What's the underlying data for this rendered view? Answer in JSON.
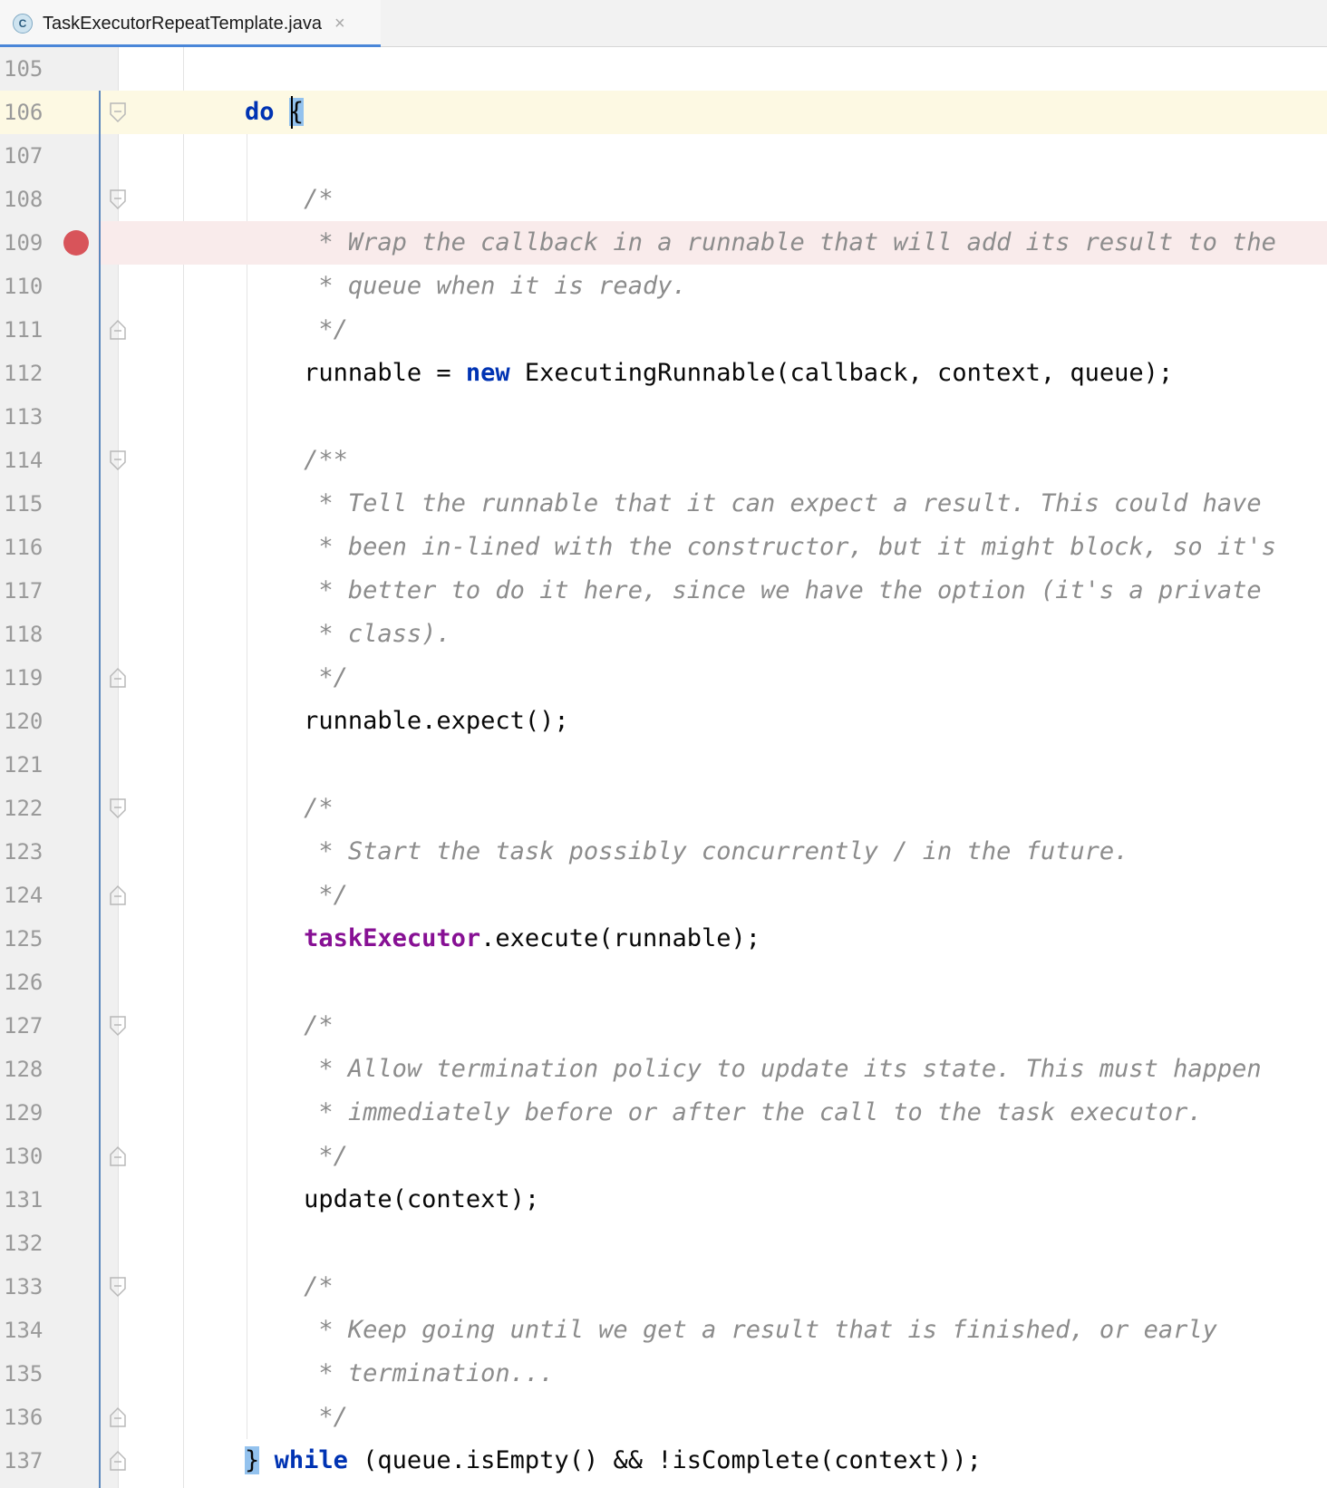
{
  "tab": {
    "icon": "class-icon",
    "icon_letter": "C",
    "title": "TaskExecutorRepeatTemplate.java",
    "close_glyph": "×"
  },
  "colors": {
    "keyword": "#0033b3",
    "field": "#871094",
    "comment": "#8c8c8c",
    "current_line": "#fdf9e3",
    "breakpoint_line": "#f9ebeb",
    "breakpoint": "#d8545a",
    "tab_underline": "#4a86d8"
  },
  "editor": {
    "current_line": 106,
    "breakpoint_line": 109,
    "lines": [
      {
        "n": "105",
        "segs": []
      },
      {
        "n": "106",
        "fold": "open",
        "segs": [
          {
            "t": "        "
          },
          {
            "t": "do",
            "c": "kw"
          },
          {
            "t": " "
          },
          {
            "t": "{",
            "c": "brace-match"
          }
        ]
      },
      {
        "n": "107",
        "segs": []
      },
      {
        "n": "108",
        "fold": "open",
        "segs": [
          {
            "t": "            "
          },
          {
            "t": "/*",
            "c": "comment"
          }
        ]
      },
      {
        "n": "109",
        "segs": [
          {
            "t": "             "
          },
          {
            "t": "* Wrap the callback in a runnable that will add its result to the",
            "c": "comment"
          }
        ]
      },
      {
        "n": "110",
        "segs": [
          {
            "t": "             "
          },
          {
            "t": "* queue when it is ready.",
            "c": "comment"
          }
        ]
      },
      {
        "n": "111",
        "fold": "close",
        "segs": [
          {
            "t": "             "
          },
          {
            "t": "*/",
            "c": "comment"
          }
        ]
      },
      {
        "n": "112",
        "segs": [
          {
            "t": "            runnable = "
          },
          {
            "t": "new",
            "c": "kw"
          },
          {
            "t": " ExecutingRunnable(callback, context, queue);"
          }
        ]
      },
      {
        "n": "113",
        "segs": []
      },
      {
        "n": "114",
        "fold": "open",
        "segs": [
          {
            "t": "            "
          },
          {
            "t": "/**",
            "c": "comment"
          }
        ]
      },
      {
        "n": "115",
        "segs": [
          {
            "t": "             "
          },
          {
            "t": "* Tell the runnable that it can expect a result. This could have",
            "c": "comment"
          }
        ]
      },
      {
        "n": "116",
        "segs": [
          {
            "t": "             "
          },
          {
            "t": "* been in-lined with the constructor, but it might block, so it's",
            "c": "comment"
          }
        ]
      },
      {
        "n": "117",
        "segs": [
          {
            "t": "             "
          },
          {
            "t": "* better to do it here, since we have the option (it's a private",
            "c": "comment"
          }
        ]
      },
      {
        "n": "118",
        "segs": [
          {
            "t": "             "
          },
          {
            "t": "* class).",
            "c": "comment"
          }
        ]
      },
      {
        "n": "119",
        "fold": "close",
        "segs": [
          {
            "t": "             "
          },
          {
            "t": "*/",
            "c": "comment"
          }
        ]
      },
      {
        "n": "120",
        "segs": [
          {
            "t": "            runnable.expect();"
          }
        ]
      },
      {
        "n": "121",
        "segs": []
      },
      {
        "n": "122",
        "fold": "open",
        "segs": [
          {
            "t": "            "
          },
          {
            "t": "/*",
            "c": "comment"
          }
        ]
      },
      {
        "n": "123",
        "segs": [
          {
            "t": "             "
          },
          {
            "t": "* Start the task possibly concurrently / in the future.",
            "c": "comment"
          }
        ]
      },
      {
        "n": "124",
        "fold": "close",
        "segs": [
          {
            "t": "             "
          },
          {
            "t": "*/",
            "c": "comment"
          }
        ]
      },
      {
        "n": "125",
        "segs": [
          {
            "t": "            "
          },
          {
            "t": "taskExecutor",
            "c": "field"
          },
          {
            "t": ".execute(runnable);"
          }
        ]
      },
      {
        "n": "126",
        "segs": []
      },
      {
        "n": "127",
        "fold": "open",
        "segs": [
          {
            "t": "            "
          },
          {
            "t": "/*",
            "c": "comment"
          }
        ]
      },
      {
        "n": "128",
        "segs": [
          {
            "t": "             "
          },
          {
            "t": "* Allow termination policy to update its state. This must happen",
            "c": "comment"
          }
        ]
      },
      {
        "n": "129",
        "segs": [
          {
            "t": "             "
          },
          {
            "t": "* immediately before or after the call to the task executor.",
            "c": "comment"
          }
        ]
      },
      {
        "n": "130",
        "fold": "close",
        "segs": [
          {
            "t": "             "
          },
          {
            "t": "*/",
            "c": "comment"
          }
        ]
      },
      {
        "n": "131",
        "segs": [
          {
            "t": "            update(context);"
          }
        ]
      },
      {
        "n": "132",
        "segs": []
      },
      {
        "n": "133",
        "fold": "open",
        "segs": [
          {
            "t": "            "
          },
          {
            "t": "/*",
            "c": "comment"
          }
        ]
      },
      {
        "n": "134",
        "segs": [
          {
            "t": "             "
          },
          {
            "t": "* Keep going until we get a result that is finished, or early",
            "c": "comment"
          }
        ]
      },
      {
        "n": "135",
        "segs": [
          {
            "t": "             "
          },
          {
            "t": "* termination...",
            "c": "comment"
          }
        ]
      },
      {
        "n": "136",
        "fold": "close",
        "segs": [
          {
            "t": "             "
          },
          {
            "t": "*/",
            "c": "comment"
          }
        ]
      },
      {
        "n": "137",
        "fold": "close",
        "segs": [
          {
            "t": "        "
          },
          {
            "t": "}",
            "c": "brace-match"
          },
          {
            "t": " "
          },
          {
            "t": "while",
            "c": "kw"
          },
          {
            "t": " (queue.isEmpty() && !isComplete(context));"
          }
        ]
      }
    ]
  }
}
